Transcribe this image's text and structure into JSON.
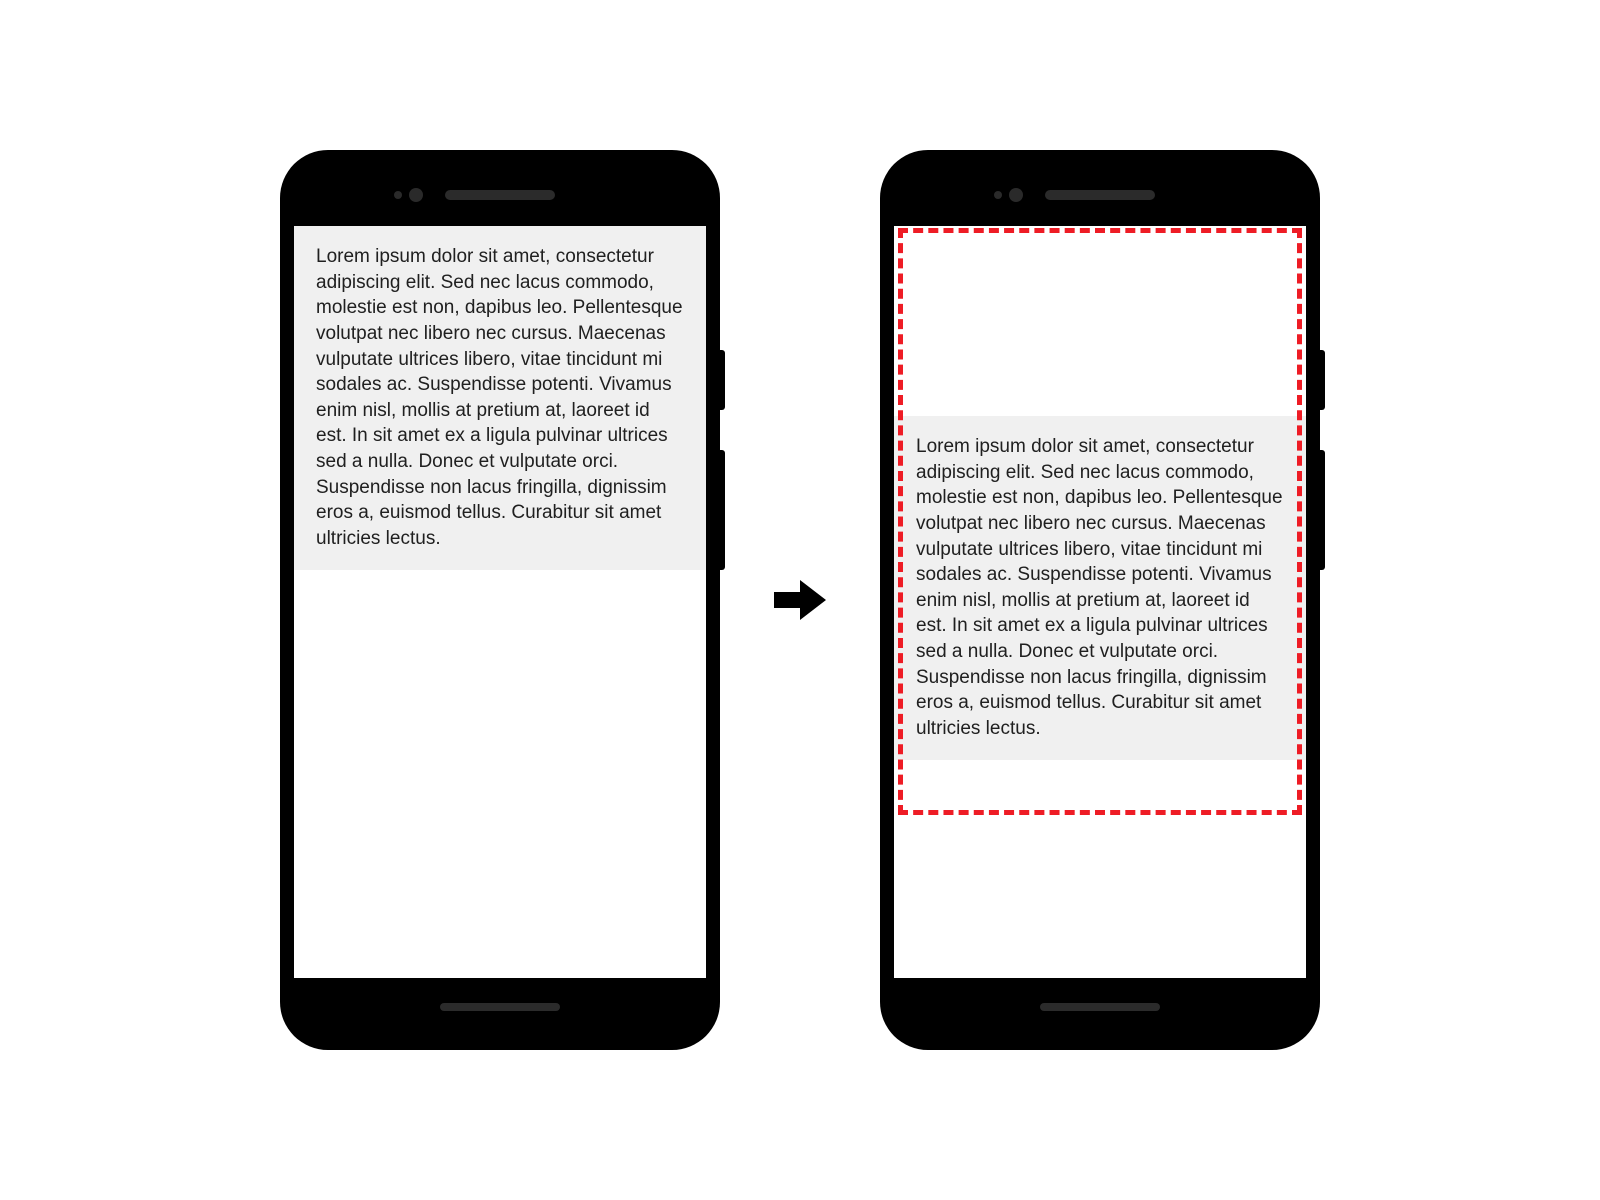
{
  "text_block": "Lorem ipsum dolor sit amet, consectetur adipiscing elit. Sed nec lacus commodo, molestie est non, dapibus leo. Pellentesque volutpat nec libero nec cursus. Maecenas vulputate ultrices libero, vitae tincidunt mi sodales ac. Suspendisse potenti. Vivamus enim nisl, mollis at pretium at, laoreet id est. In sit amet ex a ligula pulvinar ultrices sed a nulla. Donec et vulputate orci. Suspendisse non lacus fringilla, dignissim eros a, euismod tellus. Curabitur sit amet ultricies lectus.",
  "colors": {
    "highlight_border": "#ee1c25",
    "text_bg": "#f0f0f0"
  }
}
